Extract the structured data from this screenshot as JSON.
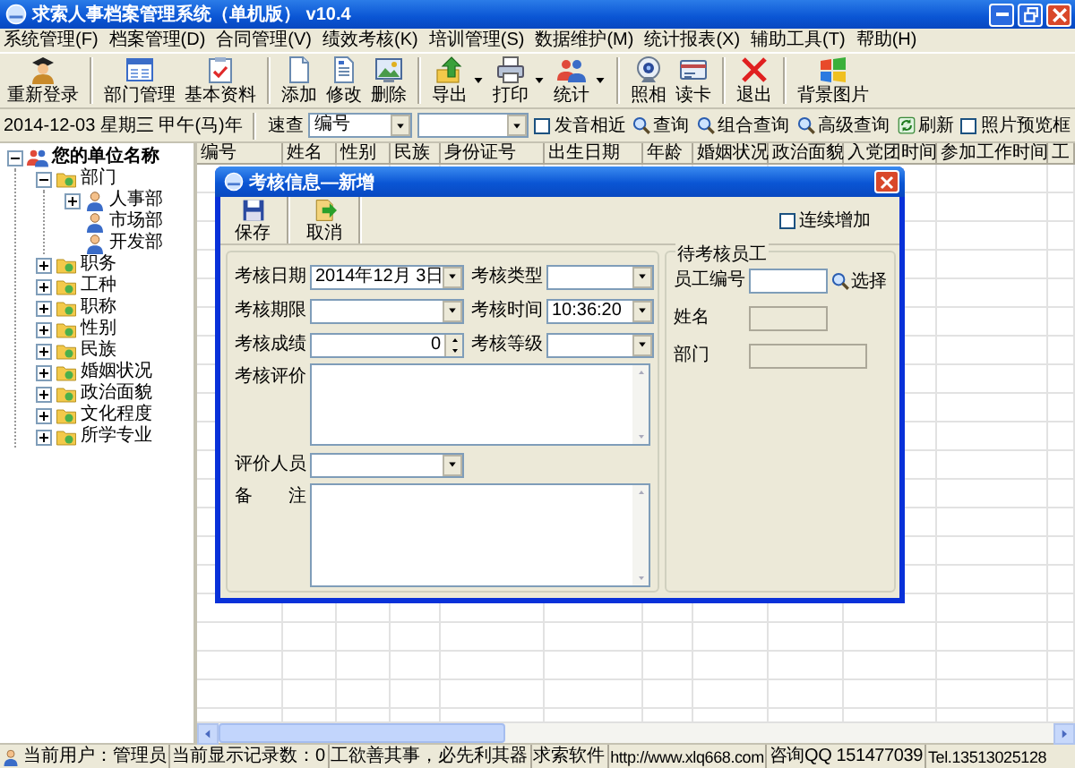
{
  "window": {
    "title": "求索人事档案管理系统（单机版） v10.4"
  },
  "menu": [
    "系统管理(F)",
    "档案管理(D)",
    "合同管理(V)",
    "绩效考核(K)",
    "培训管理(S)",
    "数据维护(M)",
    "统计报表(X)",
    "辅助工具(T)",
    "帮助(H)"
  ],
  "toolbar": {
    "groups": [
      [
        {
          "label": "重新登录",
          "menu": false
        }
      ],
      [
        {
          "label": "部门管理",
          "menu": false
        },
        {
          "label": "基本资料",
          "menu": false
        }
      ],
      [
        {
          "label": "添加",
          "menu": false
        },
        {
          "label": "修改",
          "menu": false
        },
        {
          "label": "删除",
          "menu": false
        }
      ],
      [
        {
          "label": "导出",
          "menu": true
        },
        {
          "label": "打印",
          "menu": true
        },
        {
          "label": "统计",
          "menu": true
        }
      ],
      [
        {
          "label": "照相",
          "menu": false
        },
        {
          "label": "读卡",
          "menu": false
        }
      ],
      [
        {
          "label": "退出",
          "menu": false
        }
      ],
      [
        {
          "label": "背景图片",
          "menu": false
        }
      ]
    ]
  },
  "search_bar": {
    "date": "2014-12-03 星期三 甲午(马)年",
    "quick_label": "速查",
    "field_select": "编号",
    "sound_alike": {
      "label": "发音相近",
      "checked": false
    },
    "buttons": [
      "查询",
      "组合查询",
      "高级查询",
      "刷新"
    ],
    "photo_preview": {
      "label": "照片预览框",
      "checked": false
    }
  },
  "tree": {
    "label": "您的单位名称",
    "expanded": true,
    "children": [
      {
        "label": "部门",
        "expanded": true,
        "children": [
          {
            "label": "人事部",
            "expanded": false
          },
          {
            "label": "市场部"
          },
          {
            "label": "开发部"
          }
        ]
      },
      {
        "label": "职务",
        "expanded": false
      },
      {
        "label": "工种",
        "expanded": false
      },
      {
        "label": "职称",
        "expanded": false
      },
      {
        "label": "性别",
        "expanded": false
      },
      {
        "label": "民族",
        "expanded": false
      },
      {
        "label": "婚姻状况",
        "expanded": false
      },
      {
        "label": "政治面貌",
        "expanded": false
      },
      {
        "label": "文化程度",
        "expanded": false
      },
      {
        "label": "所学专业",
        "expanded": false
      }
    ]
  },
  "table": {
    "columns": [
      "编号",
      "姓名",
      "性别",
      "民族",
      "身份证号",
      "出生日期",
      "年龄",
      "婚姻状况",
      "政治面貌",
      "入党团时间",
      "参加工作时间",
      "工"
    ]
  },
  "dialog": {
    "title": "考核信息—新增",
    "toolbar": [
      "保存",
      "取消"
    ],
    "continuous_add": {
      "label": "连续增加",
      "checked": false
    },
    "fields": [
      {
        "label": "考核日期",
        "kind": "select",
        "value": "2014年12月 3日"
      },
      {
        "label": "考核类型",
        "kind": "select"
      },
      {
        "label": "考核期限",
        "kind": "select"
      },
      {
        "label": "考核时间",
        "kind": "select",
        "value": "10:36:20"
      },
      {
        "label": "考核成绩",
        "kind": "spinner",
        "value": "0"
      },
      {
        "label": "考核等级",
        "kind": "select"
      }
    ],
    "evaluation": {
      "label": "考核评价"
    },
    "evaluator": {
      "label": "评价人员"
    },
    "remarks": {
      "label": "备　　注"
    },
    "employee_group": {
      "title": "待考核员工",
      "select_button": "选择",
      "fields": [
        {
          "label": "员工编号",
          "disabled": false
        },
        {
          "label": "姓名",
          "disabled": true
        },
        {
          "label": "部门",
          "disabled": true
        }
      ]
    }
  },
  "status_bar": [
    {
      "kind": "user",
      "text": "当前用户：管理员"
    },
    {
      "kind": "text",
      "text": "当前显示记录数：0"
    },
    {
      "kind": "text",
      "text": "工欲善其事，必先利其器"
    },
    {
      "kind": "text",
      "text": "求索软件"
    },
    {
      "kind": "text",
      "text": "http://www.xlq668.com"
    },
    {
      "kind": "text",
      "text": "咨询QQ 151477039"
    },
    {
      "kind": "text",
      "text": "Tel.13513025128"
    }
  ]
}
